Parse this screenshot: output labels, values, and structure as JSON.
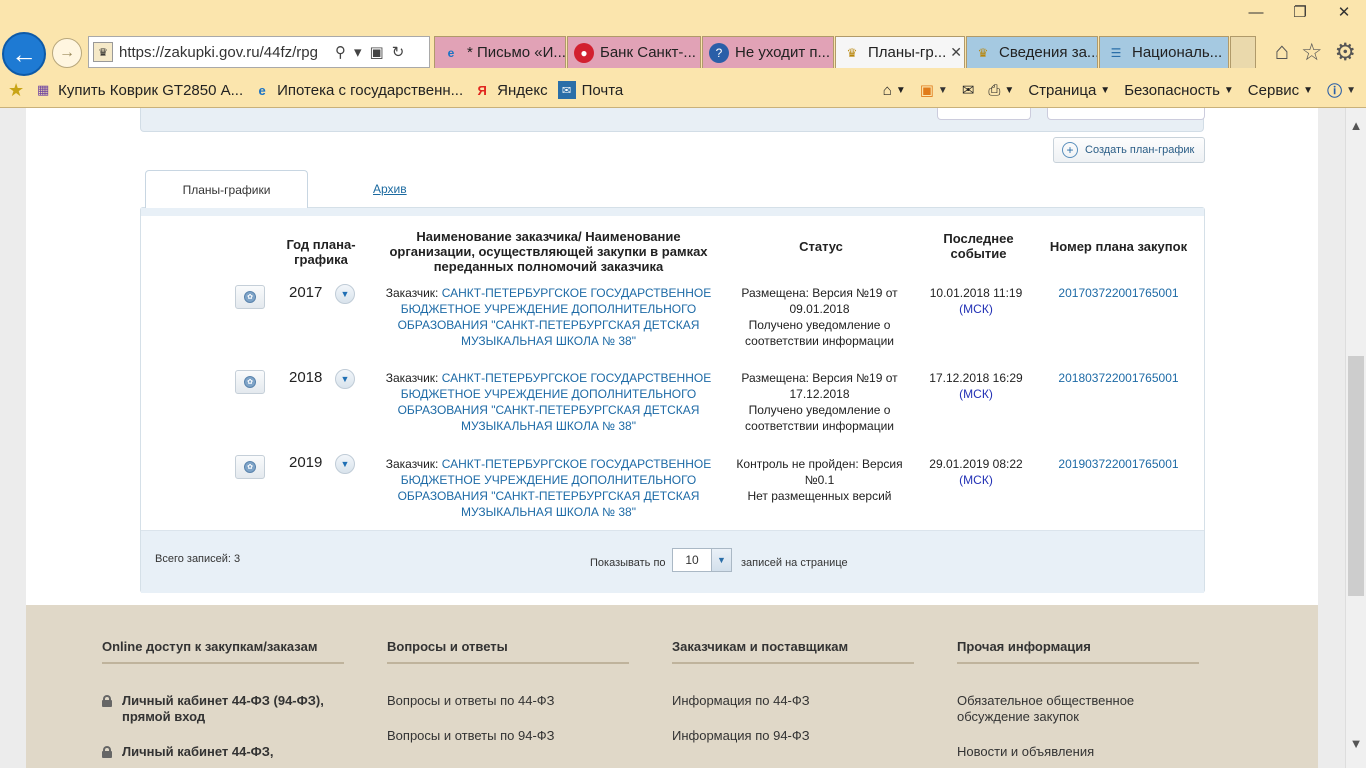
{
  "browser": {
    "url": "https://zakupki.gov.ru/44fz/rpg",
    "tabs": [
      {
        "label": "* Письмо «И...",
        "icon": "ie-icon"
      },
      {
        "label": "Банк Санкт-...",
        "icon": "bank-icon"
      },
      {
        "label": "Не уходит п...",
        "icon": "help-icon"
      },
      {
        "label": "Планы-гр...",
        "icon": "emblem-icon",
        "active": true
      },
      {
        "label": "Сведения за...",
        "icon": "emblem-icon"
      },
      {
        "label": "Националь...",
        "icon": "site-icon"
      }
    ],
    "favorites": [
      {
        "label": "Купить Коврик GT2850 А..."
      },
      {
        "label": "Ипотека с государственн..."
      },
      {
        "label": "Яндекс"
      },
      {
        "label": "Почта"
      }
    ],
    "commands": {
      "page": "Страница",
      "safety": "Безопасность",
      "service": "Сервис"
    }
  },
  "page": {
    "create_button": "Создать план-график",
    "tabs": {
      "plans": "Планы-графики",
      "archive": "Архив"
    },
    "table": {
      "headers": {
        "year": "Год плана-графика",
        "customer": "Наименование заказчика/ Наименование организации, осуществляющей закупки в рамках переданных полномочий заказчика",
        "status": "Статус",
        "last_event": "Последнее событие",
        "plan_number": "Номер плана закупок"
      },
      "rows": [
        {
          "year": "2017",
          "customer_prefix": "Заказчик: ",
          "customer_name_1": "САНКТ-ПЕТЕРБУРГСКОЕ ГОСУДАРСТВЕННОЕ",
          "customer_name_2": "БЮДЖЕТНОЕ УЧРЕЖДЕНИЕ ДОПОЛНИТЕЛЬНОГО",
          "customer_name_3": "ОБРАЗОВАНИЯ \"САНКТ-ПЕТЕРБУРГСКАЯ ДЕТСКАЯ",
          "customer_name_4": "МУЗЫКАЛЬНАЯ ШКОЛА № 38\"",
          "status_1": "Размещена: Версия №19 от",
          "status_2": "09.01.2018",
          "status_3": "Получено уведомление о",
          "status_4": "соответствии информации",
          "event_time": "10.01.2018 11:19",
          "event_tz": "(МСК)",
          "plan_number": "201703722001765001"
        },
        {
          "year": "2018",
          "customer_prefix": "Заказчик: ",
          "customer_name_1": "САНКТ-ПЕТЕРБУРГСКОЕ ГОСУДАРСТВЕННОЕ",
          "customer_name_2": "БЮДЖЕТНОЕ УЧРЕЖДЕНИЕ ДОПОЛНИТЕЛЬНОГО",
          "customer_name_3": "ОБРАЗОВАНИЯ \"САНКТ-ПЕТЕРБУРГСКАЯ ДЕТСКАЯ",
          "customer_name_4": "МУЗЫКАЛЬНАЯ ШКОЛА № 38\"",
          "status_1": "Размещена: Версия №19 от",
          "status_2": "17.12.2018",
          "status_3": "Получено уведомление о",
          "status_4": "соответствии информации",
          "event_time": "17.12.2018 16:29",
          "event_tz": "(МСК)",
          "plan_number": "201803722001765001"
        },
        {
          "year": "2019",
          "customer_prefix": "Заказчик: ",
          "customer_name_1": "САНКТ-ПЕТЕРБУРГСКОЕ ГОСУДАРСТВЕННОЕ",
          "customer_name_2": "БЮДЖЕТНОЕ УЧРЕЖДЕНИЕ ДОПОЛНИТЕЛЬНОГО",
          "customer_name_3": "ОБРАЗОВАНИЯ \"САНКТ-ПЕТЕРБУРГСКАЯ ДЕТСКАЯ",
          "customer_name_4": "МУЗЫКАЛЬНАЯ ШКОЛА № 38\"",
          "status_1": "Контроль не пройден: Версия",
          "status_2": "№0.1",
          "status_3": "Нет размещенных версий",
          "status_4": "",
          "event_time": "29.01.2019 08:22",
          "event_tz": "(МСК)",
          "plan_number": "201903722001765001"
        }
      ]
    },
    "pagination": {
      "total": "Всего записей: 3",
      "show_by": "Показывать по",
      "per_page": "10",
      "on_page": "записей на странице"
    }
  },
  "footer": {
    "col1": {
      "title": "Online доступ к закупкам/заказам",
      "link1": "Личный кабинет 44-ФЗ (94-ФЗ), прямой вход",
      "link2": "Личный кабинет 44-ФЗ,"
    },
    "col2": {
      "title": "Вопросы и ответы",
      "link1": "Вопросы и ответы по 44-ФЗ",
      "link2": "Вопросы и ответы по 94-ФЗ"
    },
    "col3": {
      "title": "Заказчикам и поставщикам",
      "link1": "Информация по 44-ФЗ",
      "link2": "Информация по 94-ФЗ"
    },
    "col4": {
      "title": "Прочая информация",
      "link1": "Обязательное общественное обсуждение закупок",
      "link2": "Новости и объявления"
    }
  }
}
